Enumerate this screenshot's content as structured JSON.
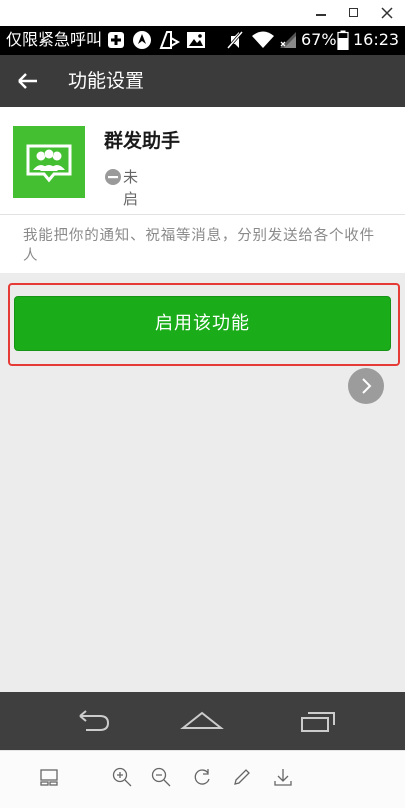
{
  "status_bar": {
    "carrier_text": "仅限紧急呼叫",
    "battery_percent": "67%",
    "time": "16:23"
  },
  "app_bar": {
    "title": "功能设置"
  },
  "feature": {
    "name": "群发助手",
    "status": "未启用",
    "description": "我能把你的通知、祝福等消息，分别发送给各个收件人"
  },
  "actions": {
    "enable_label": "启用该功能"
  },
  "colors": {
    "app_bar": "#3b3b3b",
    "logo_green": "#44bf32",
    "button_green": "#1aad19",
    "highlight_red": "#e53a36"
  },
  "icons": {
    "window": [
      "minimize-icon",
      "maximize-icon",
      "close-icon"
    ],
    "status_bar": [
      "plus-box-icon",
      "navigation-icon",
      "cleaner-icon",
      "image-icon",
      "mute-icon",
      "wifi-icon",
      "signal-icon",
      "battery-icon"
    ],
    "nav_bar": [
      "back-icon",
      "home-icon",
      "recents-icon"
    ],
    "toolbar": [
      "layout-icon",
      "zoom-in-icon",
      "zoom-out-icon",
      "rotate-icon",
      "edit-icon",
      "download-icon"
    ]
  }
}
